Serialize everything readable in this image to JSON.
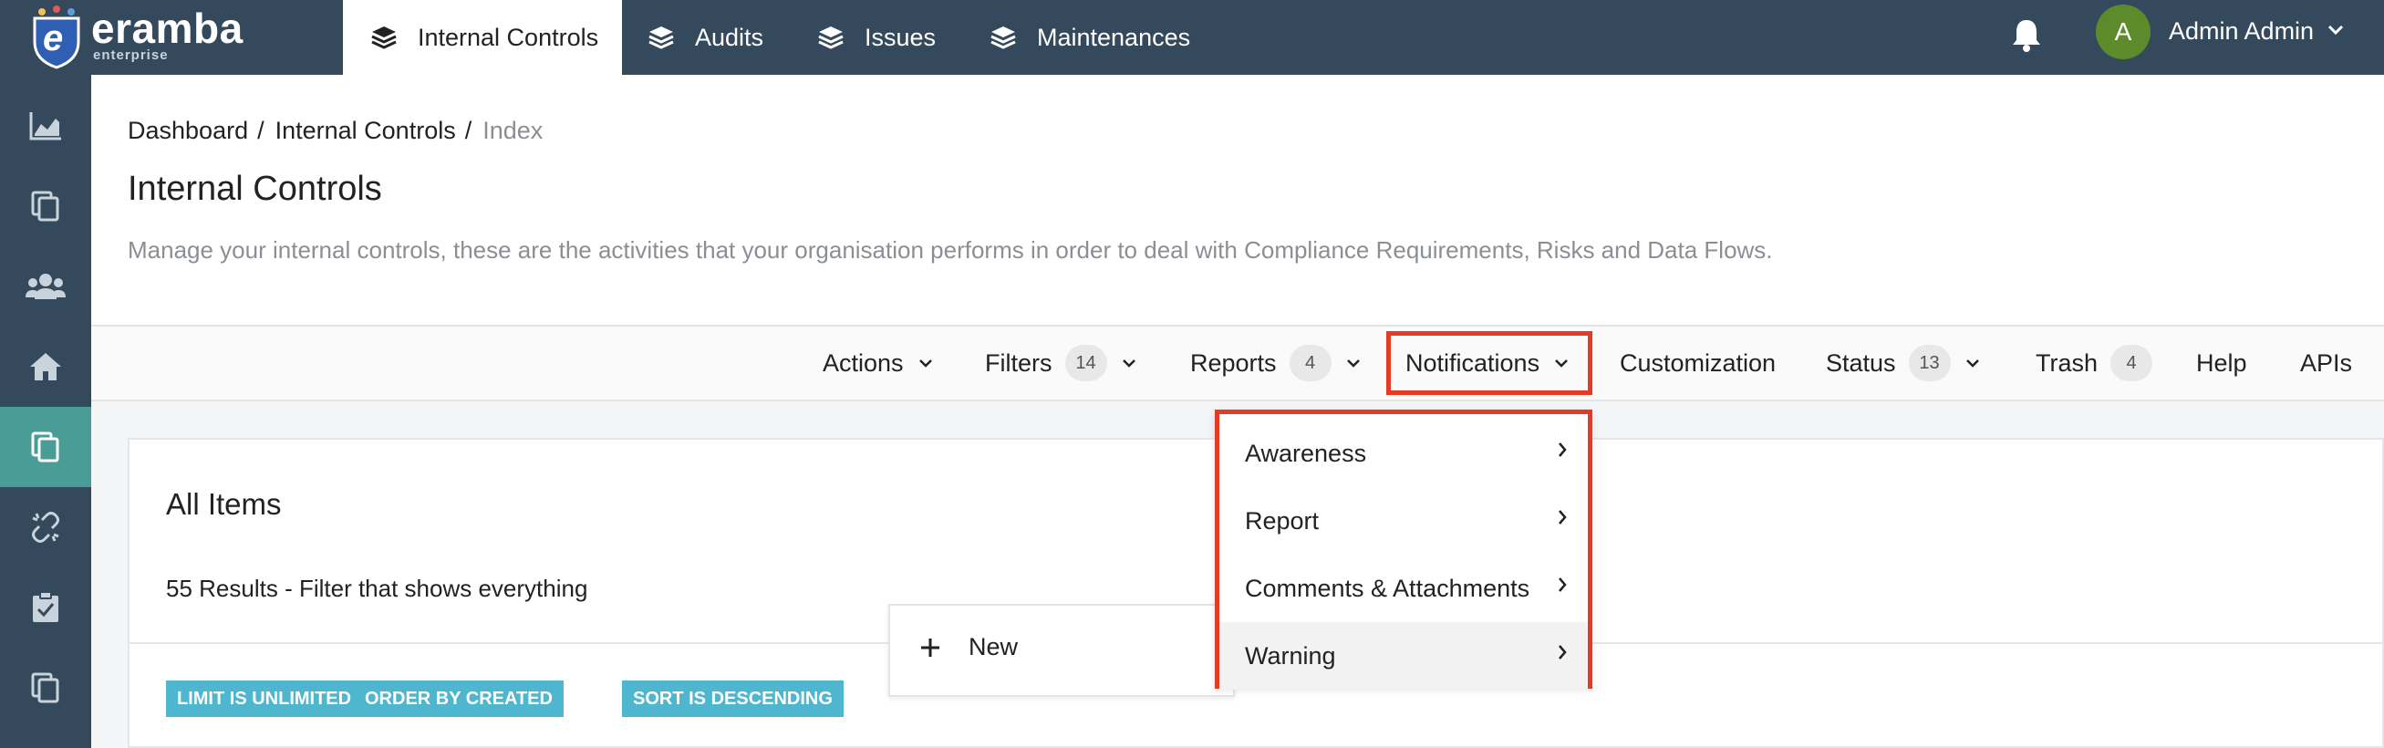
{
  "brand": {
    "name": "eramba",
    "edition": "enterprise",
    "shield_letter": "e"
  },
  "top_nav": {
    "tabs": [
      {
        "label": "Internal Controls",
        "icon": "layers-icon",
        "active": true
      },
      {
        "label": "Audits",
        "icon": "layers-icon",
        "active": false
      },
      {
        "label": "Issues",
        "icon": "layers-icon",
        "active": false
      },
      {
        "label": "Maintenances",
        "icon": "layers-icon",
        "active": false
      }
    ],
    "notifications_icon": "bell-icon",
    "user": {
      "initial": "A",
      "name": "Admin Admin"
    }
  },
  "sidebar": {
    "items": [
      {
        "icon": "chart-icon",
        "active": false
      },
      {
        "icon": "copy-icon",
        "active": false
      },
      {
        "icon": "users-icon",
        "active": false
      },
      {
        "icon": "home-icon",
        "active": false
      },
      {
        "icon": "copy-icon",
        "active": true
      },
      {
        "icon": "unlink-icon",
        "active": false
      },
      {
        "icon": "clipboard-check-icon",
        "active": false
      },
      {
        "icon": "copy-icon",
        "active": false
      }
    ]
  },
  "breadcrumb": {
    "items": [
      "Dashboard",
      "Internal Controls"
    ],
    "current": "Index",
    "separator": "/"
  },
  "page": {
    "title": "Internal Controls",
    "description": "Manage your internal controls, these are the activities that your organisation performs in order to deal with Compliance Requirements, Risks and Data Flows."
  },
  "toolbar": {
    "actions": "Actions",
    "filters": {
      "label": "Filters",
      "count": "14"
    },
    "reports": {
      "label": "Reports",
      "count": "4"
    },
    "notifications": "Notifications",
    "customization": "Customization",
    "status": {
      "label": "Status",
      "count": "13"
    },
    "trash": {
      "label": "Trash",
      "count": "4"
    },
    "help": "Help",
    "apis": "APIs"
  },
  "notifications_menu": {
    "items": [
      "Awareness",
      "Report",
      "Comments & Attachments",
      "Warning"
    ],
    "hovered_index": 3
  },
  "card": {
    "title": "All Items",
    "subtitle": "55 Results - Filter that shows everything",
    "tags": [
      "LIMIT IS UNLIMITED",
      "ORDER BY CREATED",
      "SORT IS DESCENDING"
    ]
  },
  "new_menu": {
    "label": "New"
  },
  "colors": {
    "topbar": "#34495b",
    "sidebar_active": "#4a9d96",
    "highlight": "#e53a24",
    "tag": "#4fb6cf",
    "avatar": "#5d8a2a"
  }
}
